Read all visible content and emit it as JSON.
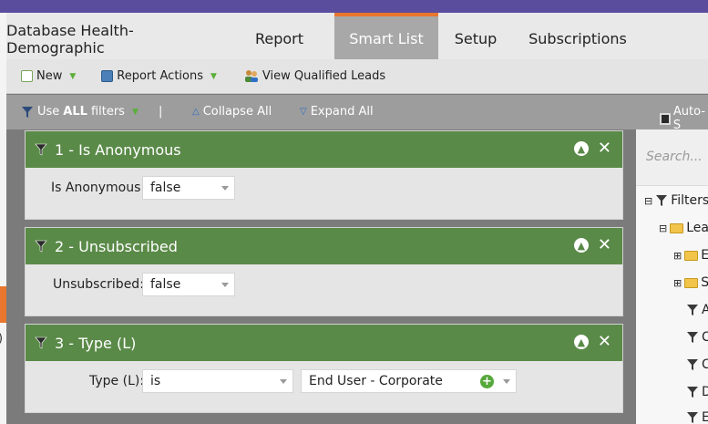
{
  "tabs": [
    {
      "label": "Database Health-Demographic",
      "active": false
    },
    {
      "label": "Report",
      "active": false
    },
    {
      "label": "Smart List",
      "active": true
    },
    {
      "label": "Setup",
      "active": false
    },
    {
      "label": "Subscriptions",
      "active": false
    }
  ],
  "toolbar": {
    "new_label": "New",
    "report_actions_label": "Report Actions",
    "view_qualified_label": "View Qualified Leads"
  },
  "filterbar": {
    "use_prefix": "Use",
    "use_all": "ALL",
    "use_suffix": "filters",
    "separator": "|",
    "collapse_label": "Collapse All",
    "expand_label": "Expand All",
    "autosave_label": "Auto-S"
  },
  "filters": [
    {
      "title": "1 - Is Anonymous",
      "field_label": "Is Anonymous:",
      "value": "false"
    },
    {
      "title": "2 - Unsubscribed",
      "field_label": "Unsubscribed:",
      "value": "false"
    },
    {
      "title": "3 - Type (L)",
      "field_label": "Type (L):",
      "operator": "is",
      "value": "End User - Corporate"
    }
  ],
  "sidebar": {
    "search_placeholder": "Search...",
    "tree": [
      {
        "label": "Filters",
        "pm": "⊟"
      },
      {
        "label": "Lea",
        "pm": "⊟"
      },
      {
        "label": "E",
        "pm": "⊞"
      },
      {
        "label": "S",
        "pm": "⊞"
      },
      {
        "label": "A"
      },
      {
        "label": "C"
      },
      {
        "label": "C"
      },
      {
        "label": "D"
      },
      {
        "label": "E"
      }
    ]
  },
  "left_edge_text": ")",
  "colors": {
    "topbar": "#5b4d9e",
    "accent_orange": "#e8762d",
    "panel_green": "#5a8a48",
    "caret_green": "#5bae3a",
    "link_blue": "#2f6fc4"
  },
  "icons": {
    "new": "new-document-icon",
    "report_actions": "report-actions-icon",
    "view_qualified": "people-icon",
    "filter": "funnel-icon",
    "move_up": "arrow-up-icon",
    "remove": "close-icon",
    "add": "plus-icon",
    "save": "floppy-icon",
    "folder": "folder-icon"
  }
}
